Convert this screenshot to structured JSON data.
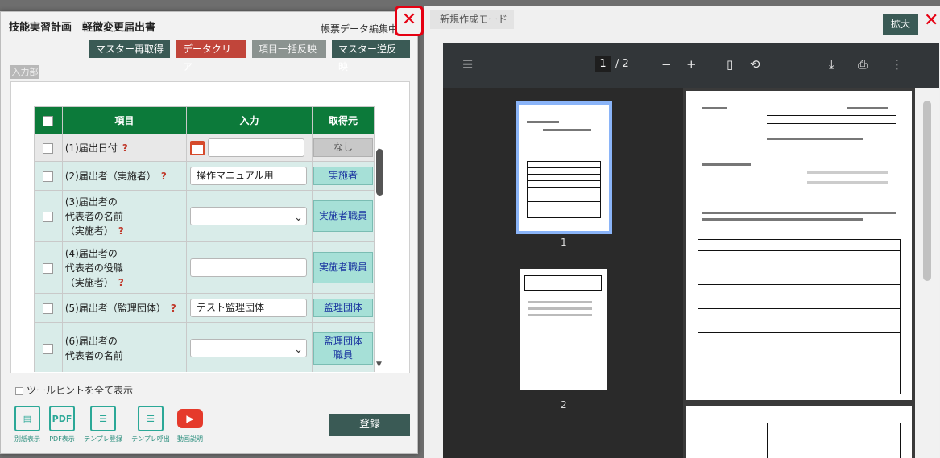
{
  "dialog": {
    "title": "技能実習計画　軽微変更届出書",
    "mode": "帳票データ編集中",
    "close_icon": "✕",
    "toolbar": {
      "remaster": "マスター再取得",
      "clear": "データクリア",
      "bulk": "項目一括反映",
      "reverse": "マスター逆反映"
    },
    "input_tag": "入力部",
    "table": {
      "headers": [
        "",
        "項目",
        "入力",
        "取得元"
      ],
      "rows": [
        {
          "label": "(1)届出日付",
          "input": "",
          "source": "なし"
        },
        {
          "label": "(2)届出者（実施者）",
          "input": "操作マニュアル用",
          "source": "実施者"
        },
        {
          "label": "(3)届出者の\n代表者の名前\n（実施者）",
          "input": "",
          "source": "実施者職員"
        },
        {
          "label": "(4)届出者の\n代表者の役職\n（実施者）",
          "input": "",
          "source": "実施者職員"
        },
        {
          "label": "(5)届出者（監理団体）",
          "input": "テスト監理団体",
          "source": "監理団体"
        },
        {
          "label": "(6)届出者の\n代表者の名前",
          "input": "",
          "source": "監理団体\n職員"
        }
      ]
    },
    "tooltip_label": "ツールヒントを全て表示",
    "icons": {
      "print": "別紙表示",
      "pdf": "PDF表示",
      "template_save": "テンプレ登録",
      "template_out": "テンプレ呼出",
      "video": "動画説明"
    },
    "register": "登録"
  },
  "right": {
    "mode": "新規作成モード",
    "expand": "拡大",
    "close_icon": "✕",
    "pdf": {
      "page_current": "1",
      "page_sep": "/",
      "page_total": "2",
      "thumb1": "1",
      "thumb2": "2"
    }
  },
  "colors": {
    "header_green": "#0c7a3a",
    "button_teal": "#3a5a55",
    "clear_red": "#c1453a",
    "source_cyan": "#a6e0d7",
    "accent_red": "#e60012"
  }
}
